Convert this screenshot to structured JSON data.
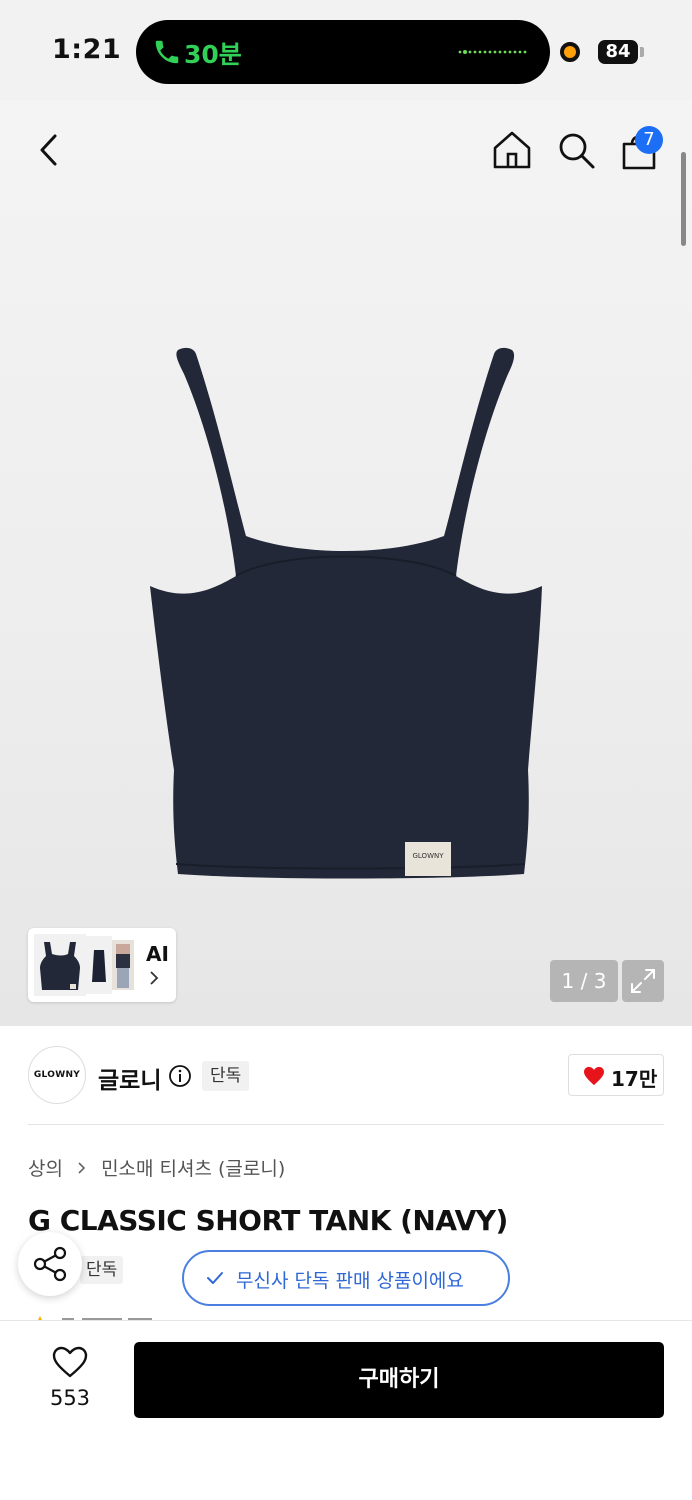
{
  "status_bar": {
    "time": "1:21",
    "call_duration": "30분",
    "battery": "84"
  },
  "header": {
    "cart_count": "7"
  },
  "gallery": {
    "ai_label": "AI",
    "pager": "1 / 3",
    "label_text": "GLOWNY"
  },
  "brand": {
    "logo_text": "GLOWNY",
    "name": "글로니",
    "tag": "단독",
    "likes": "17만",
    "heart_color": "#e8141c"
  },
  "product": {
    "breadcrumb": [
      "상의",
      "민소매 티셔츠 (글로니)"
    ],
    "title": "G CLASSIC SHORT TANK (NAVY)",
    "tag": "단독",
    "toast": "무신사 단독 판매 상품이에요"
  },
  "bottom_bar": {
    "wish_count": "553",
    "buy_label": "구매하기"
  },
  "icons": [
    "back-icon",
    "home-icon",
    "search-icon",
    "cart-icon",
    "expand-icon",
    "info-icon",
    "heart-icon",
    "share-icon",
    "check-icon",
    "phone-icon"
  ],
  "colors": {
    "accent": "#1c6ef5",
    "toast_border": "#4a7fe0",
    "call_green": "#31d158"
  }
}
